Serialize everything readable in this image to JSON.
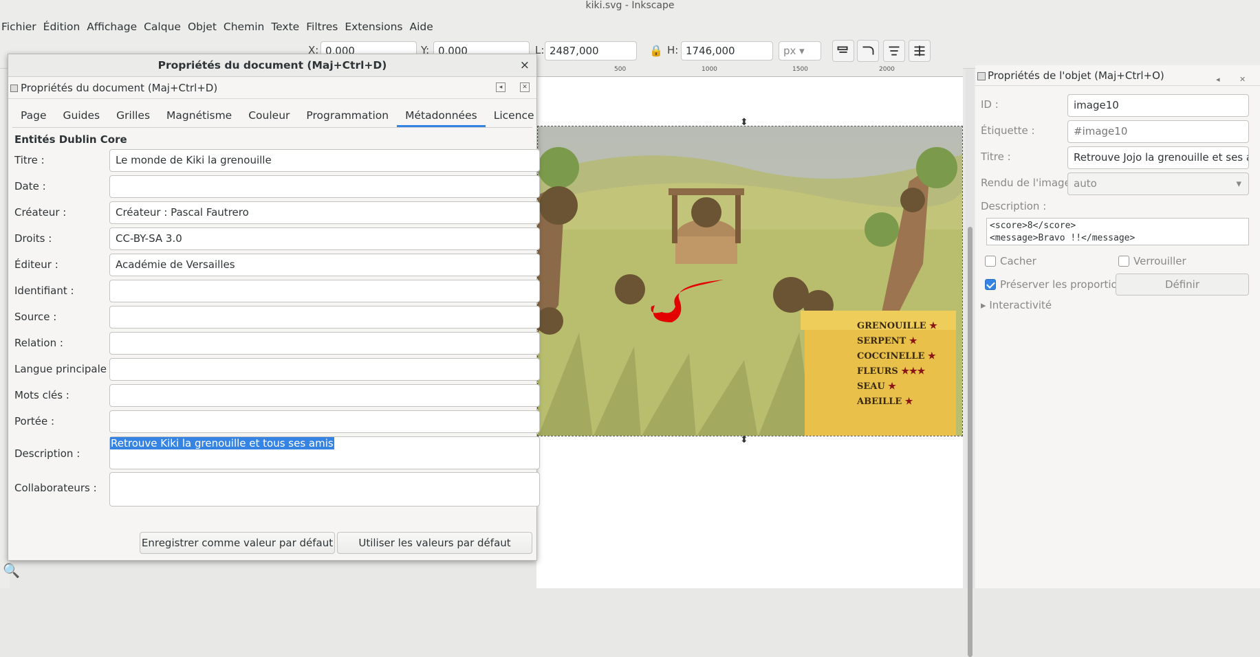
{
  "window": {
    "title": "kiki.svg - Inkscape"
  },
  "menu": [
    "Fichier",
    "Édition",
    "Affichage",
    "Calque",
    "Objet",
    "Chemin",
    "Texte",
    "Filtres",
    "Extensions",
    "Aide"
  ],
  "toolbar": {
    "x_label": "X:",
    "x_value": "0,000",
    "y_label": "Y:",
    "y_value": "0,000",
    "w_label": "L:",
    "w_value": "2487,000",
    "h_label": "H:",
    "h_value": "1746,000",
    "unit": "px"
  },
  "ruler": {
    "ticks": [
      "500",
      "1000",
      "1500",
      "2000"
    ]
  },
  "scene": {
    "sign_items": [
      "GRENOUILLE",
      "SERPENT",
      "COCCINELLE",
      "FLEURS",
      "SEAU",
      "ABEILLE"
    ],
    "sign_stars": [
      1,
      1,
      1,
      3,
      1,
      1
    ]
  },
  "dialog": {
    "title": "Propriétés du document (Maj+Ctrl+D)",
    "close": "×",
    "subtitle": "Propriétés du document (Maj+Ctrl+D)",
    "tabs": [
      "Page",
      "Guides",
      "Grilles",
      "Magnétisme",
      "Couleur",
      "Programmation",
      "Métadonnées",
      "Licence"
    ],
    "active_tab": 6,
    "section": "Entités Dublin Core",
    "fields": [
      {
        "label": "Titre :",
        "value": "Le monde de Kiki la grenouille"
      },
      {
        "label": "Date :",
        "value": ""
      },
      {
        "label": "Créateur :",
        "value": "Créateur : Pascal Fautrero"
      },
      {
        "label": "Droits :",
        "value": "CC-BY-SA 3.0"
      },
      {
        "label": "Éditeur :",
        "value": "Académie de Versailles"
      },
      {
        "label": "Identifiant :",
        "value": ""
      },
      {
        "label": "Source :",
        "value": ""
      },
      {
        "label": "Relation :",
        "value": ""
      },
      {
        "label": "Langue principale :",
        "value": ""
      },
      {
        "label": "Mots clés :",
        "value": ""
      },
      {
        "label": "Portée :",
        "value": ""
      }
    ],
    "description_label": "Description :",
    "description_value": "Retrouve Kiki la grenouille et tous ses amis",
    "collab_label": "Collaborateurs :",
    "collab_value": "",
    "save_default": "Enregistrer comme valeur par défaut",
    "use_default": "Utiliser les valeurs par défaut"
  },
  "objpanel": {
    "title": "Propriétés de l'objet (Maj+Ctrl+O)",
    "id_label": "ID :",
    "id_value": "image10",
    "label_label": "Étiquette :",
    "label_value": "#image10",
    "title_label": "Titre :",
    "title_value": "Retrouve Jojo la grenouille et ses amis",
    "render_label": "Rendu de l'image :",
    "render_value": "auto",
    "desc_label": "Description :",
    "desc_line1": "<score>8</score>",
    "desc_line2": "<message>Bravo !!</message>",
    "hide_label": "Cacher",
    "lock_label": "Verrouiller",
    "preserve_label": "Préserver les proportions",
    "define_label": "Définir",
    "interactivity_label": "Interactivité"
  },
  "colors": {
    "accent": "#3584e4",
    "bg": "#f6f5f4"
  }
}
